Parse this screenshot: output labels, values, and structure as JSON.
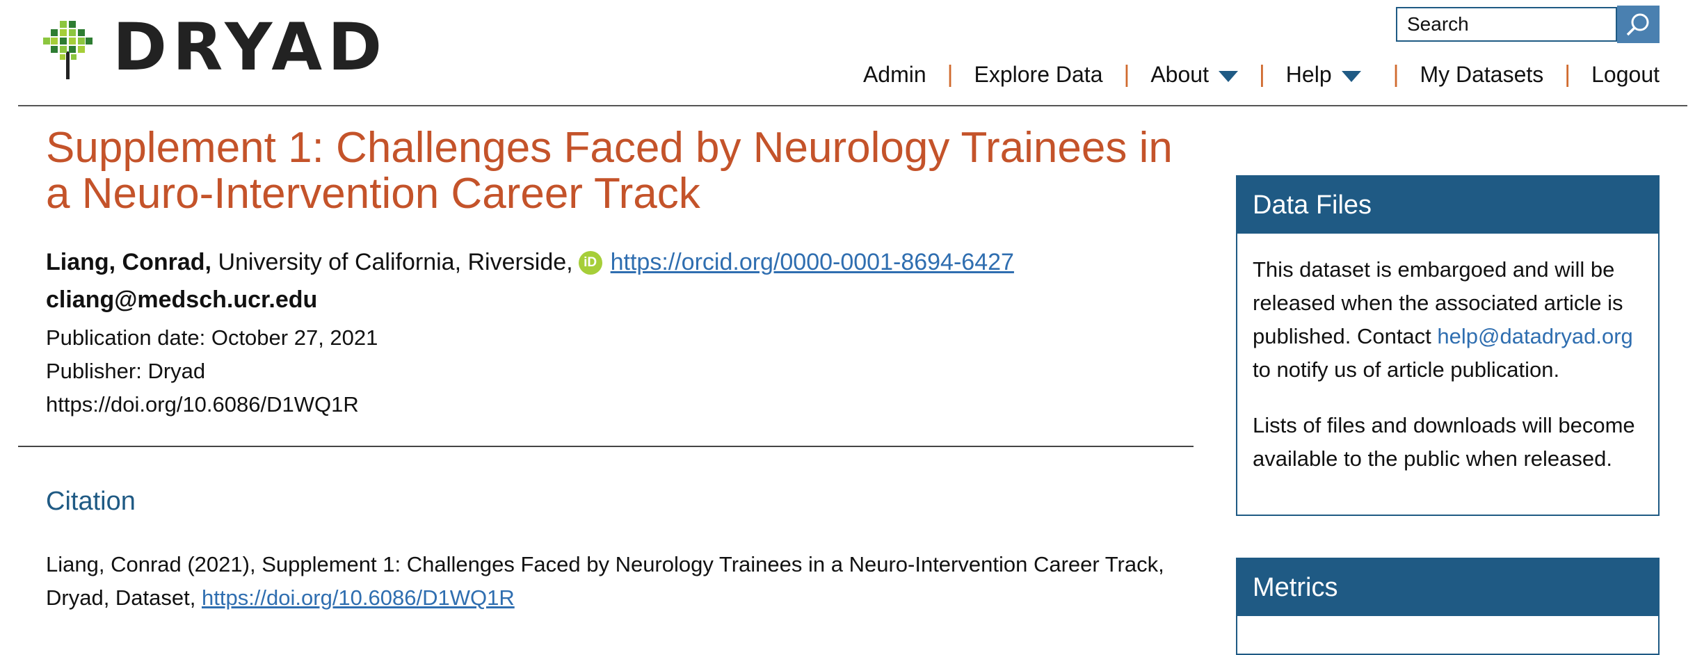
{
  "header": {
    "logo_text": "DRYAD",
    "search": {
      "placeholder": "Search",
      "button_icon": "search-icon"
    },
    "nav": {
      "admin": "Admin",
      "explore": "Explore Data",
      "about": "About",
      "help": "Help",
      "my_datasets": "My Datasets",
      "logout": "Logout",
      "separator": "|"
    }
  },
  "dataset": {
    "title": "Supplement 1: Challenges Faced by Neurology Trainees in a Neuro-Intervention Career Track",
    "author": {
      "name": "Liang, Conrad,",
      "affiliation": "University of California, Riverside,",
      "orcid_icon_text": "iD",
      "orcid_url": "https://orcid.org/0000-0001-8694-6427",
      "email": "cliang@medsch.ucr.edu"
    },
    "publication_date": "Publication date: October 27, 2021",
    "publisher": "Publisher: Dryad",
    "doi": "https://doi.org/10.6086/D1WQ1R"
  },
  "citation": {
    "heading": "Citation",
    "text": "Liang, Conrad (2021), Supplement 1: Challenges Faced by Neurology Trainees in a Neuro-Intervention Career Track, Dryad, Dataset, ",
    "link": "https://doi.org/10.6086/D1WQ1R"
  },
  "sidebar": {
    "data_files": {
      "title": "Data Files",
      "embargo_pre": "This dataset is embargoed and will be released when the associated article is published. Contact ",
      "embargo_link": "help@datadryad.org",
      "embargo_post": " to notify us of article publication.",
      "release_note": "Lists of files and downloads will become available to the public when released."
    },
    "metrics": {
      "title": "Metrics"
    }
  },
  "colors": {
    "title": "#c4532a",
    "accent": "#1f5a84",
    "link": "#2f6eb0",
    "separator": "#d06a2e",
    "orcid": "#a6ce39"
  }
}
